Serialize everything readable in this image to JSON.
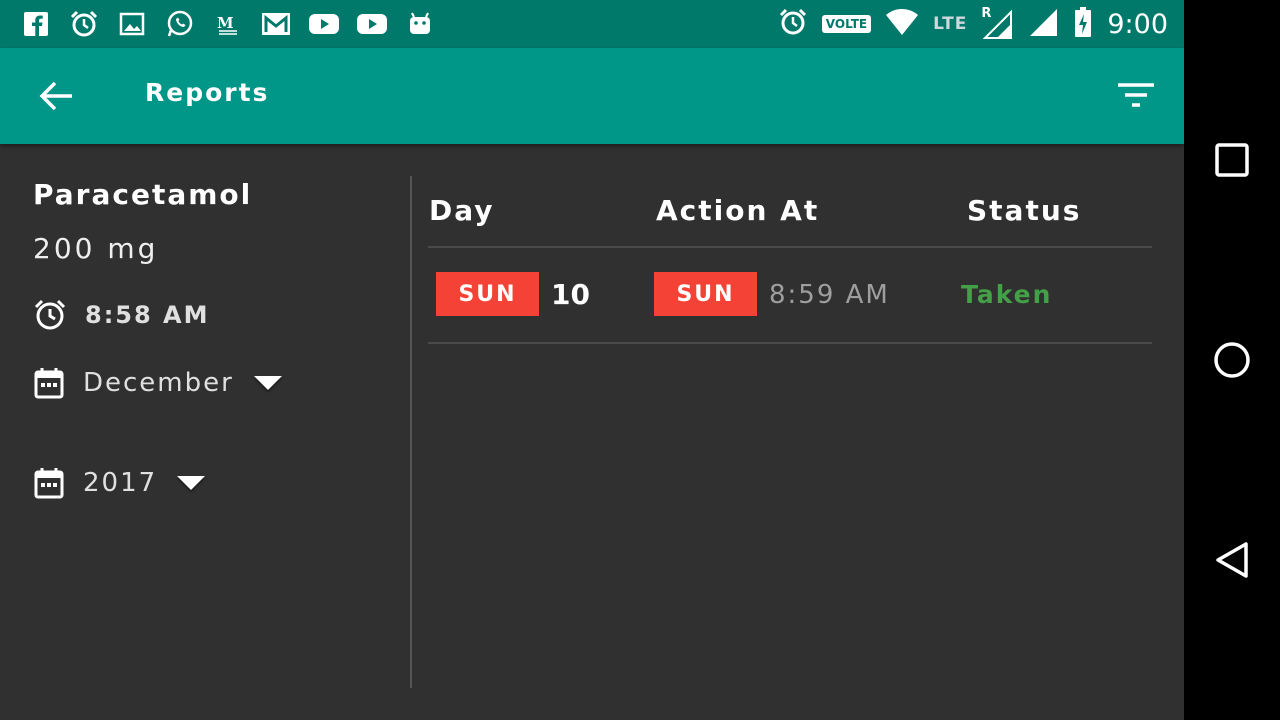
{
  "status_bar": {
    "time": "9:00",
    "volte": "VOLTE",
    "network": "LTE",
    "roaming": "R",
    "notification_icons": [
      "facebook-icon",
      "alarm-clock-icon",
      "image-icon",
      "whatsapp-icon",
      "medium-icon",
      "gmail-icon",
      "youtube-icon",
      "youtube-icon",
      "android-icon"
    ]
  },
  "app_bar": {
    "title": "Reports"
  },
  "medicine": {
    "name": "Paracetamol",
    "dose": "200 mg",
    "time": "8:58 AM",
    "month": "December",
    "year": "2017"
  },
  "table": {
    "headers": {
      "day": "Day",
      "action_at": "Action At",
      "status": "Status"
    },
    "rows": [
      {
        "day_label": "SUN",
        "day_number": "10",
        "action_day": "SUN",
        "action_time": "8:59 AM",
        "status": "Taken"
      }
    ]
  },
  "colors": {
    "status_bar": "#00796b",
    "app_bar": "#009688",
    "background": "#303030",
    "badge": "#f44336",
    "taken": "#43a047"
  }
}
